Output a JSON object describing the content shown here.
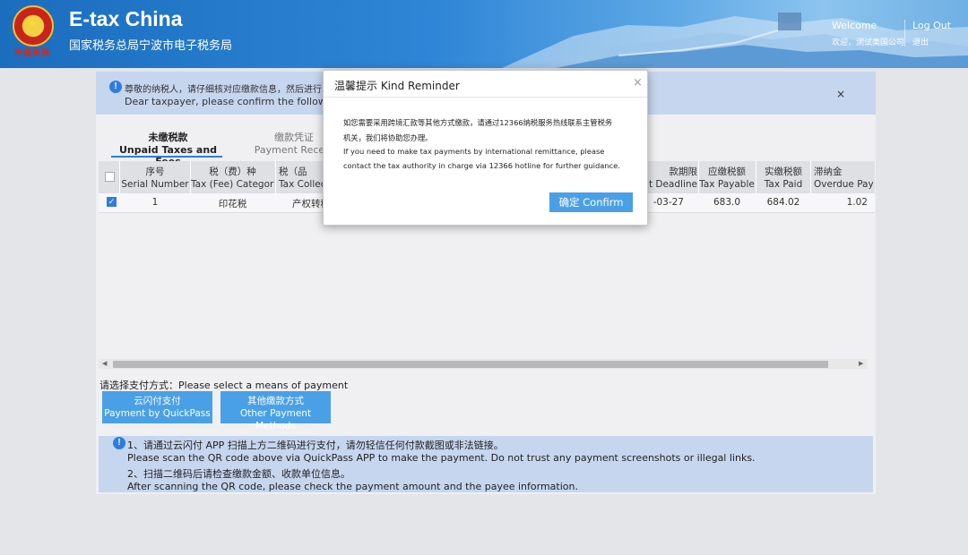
{
  "header": {
    "title": "E-tax China",
    "subtitle": "国家税务总局宁波市电子税务局",
    "emblem_text": "中國稅務",
    "welcome": "Welcome",
    "user": "欢迎，测试类国公司",
    "logout": "Log Out",
    "exit": "退出"
  },
  "notice": {
    "cn": "尊敬的纳税人，请仔细核对应缴款信息，然后进行",
    "en": "Dear taxpayer, please confirm the following p",
    "close": "×"
  },
  "tabs": [
    {
      "cn": "未缴税款",
      "en": "Unpaid Taxes and Fees"
    },
    {
      "cn": "缴款凭证",
      "en": "Payment Receip"
    }
  ],
  "table": {
    "headers": [
      {
        "cn": "序号",
        "en": "Serial Number"
      },
      {
        "cn": "税（费）种",
        "en": "Tax (Fee) Category"
      },
      {
        "cn": "税（品",
        "en": "Tax Collec"
      },
      {
        "cn": "款期限",
        "en": "t Deadline"
      },
      {
        "cn": "应缴税额",
        "en": "Tax Payable"
      },
      {
        "cn": "实缴税额",
        "en": "Tax Paid"
      },
      {
        "cn": "滞纳金",
        "en": "Overdue Pay"
      }
    ],
    "row": {
      "checked": true,
      "serial": "1",
      "category": "印花税",
      "collection": "产权转移",
      "deadline": "-03-27",
      "payable": "683.0",
      "paid": "684.02",
      "overdue": "1.02"
    }
  },
  "payment": {
    "label": "请选择支付方式：Please select a means of payment",
    "quickpass": {
      "cn": "云闪付支付",
      "en": "Payment by QuickPass"
    },
    "other": {
      "cn": "其他缴款方式",
      "en": "Other Payment Methods"
    }
  },
  "tips": {
    "line1": "1、请通过云闪付 APP 扫描上方二维码进行支付，请勿轻信任何付款截图或非法链接。",
    "line2": "Please scan the QR code above via QuickPass APP to make the payment. Do not trust any payment screenshots or illegal links.",
    "line3": "2、扫描二维码后请检查缴款金额、收款单位信息。",
    "line4": "After scanning the QR code, please check the payment amount and the payee information."
  },
  "modal": {
    "title": "温馨提示 Kind Reminder",
    "close": "×",
    "cn_line1": "如您需要采用跨境汇款等其他方式缴款，请通过12366纳税服务热线联系主管税务",
    "cn_line2": "机关，我们将协助您办理。",
    "en_line1": "If you need to make tax payments by international remittance, please",
    "en_line2": "contact the tax authority in charge via 12366 hotline for further guidance.",
    "confirm": "确定 Confirm"
  },
  "colors": {
    "accent": "#4aa0e6",
    "header_blue": "#1b6dbe",
    "notice_bg": "#c6d6ef"
  }
}
